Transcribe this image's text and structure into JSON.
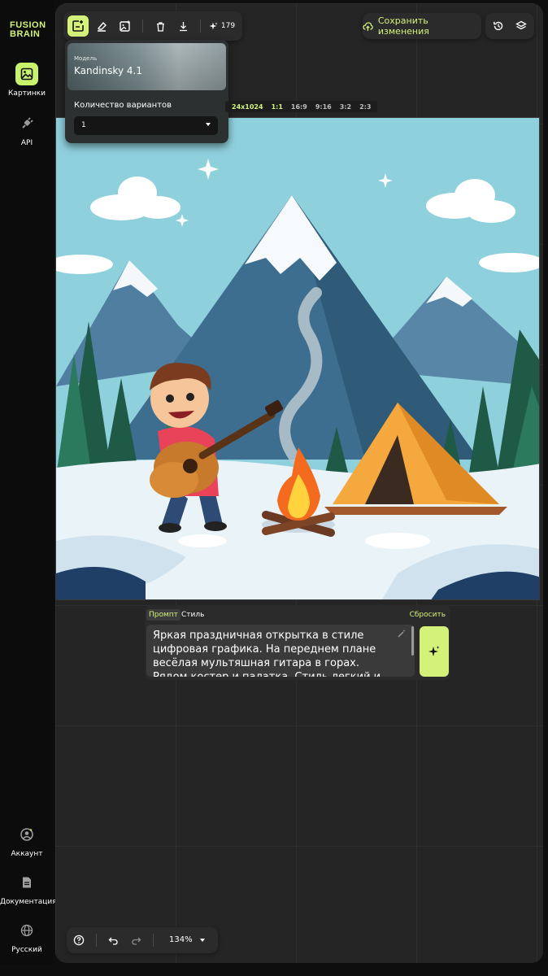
{
  "brand": {
    "line1": "FUSION",
    "line2": "BRAIN"
  },
  "sidebar": {
    "top": [
      {
        "label": "Картинки",
        "icon": "image-icon",
        "active": true
      },
      {
        "label": "API",
        "icon": "plug-icon",
        "active": false
      }
    ],
    "bottom": [
      {
        "label": "Аккаунт",
        "icon": "user-icon"
      },
      {
        "label": "Документация",
        "icon": "document-icon"
      },
      {
        "label": "Русский",
        "icon": "globe-icon"
      }
    ]
  },
  "toolbar": {
    "credits": "179",
    "save_label": "Сохранить изменения"
  },
  "model_panel": {
    "caption": "Модель",
    "model_name": "Kandinsky 4.1",
    "count_label": "Количество вариантов",
    "count_value": "1"
  },
  "aspect": {
    "size": "24x1024",
    "ratios": [
      "1:1",
      "16:9",
      "9:16",
      "3:2",
      "2:3"
    ],
    "selected": "1:1"
  },
  "prompt": {
    "tab_prompt": "Промпт",
    "tab_style": "Стиль",
    "reset": "Сбросить",
    "text": "Яркая праздничная открытка в стиле цифровая графика. На переднем плане весёлая мультяшная гитара в горах. Рядом костер и палатка. Стиль легкий и"
  },
  "bottom_bar": {
    "zoom": "134%"
  },
  "colors": {
    "accent": "#d4f27a",
    "workspace": "#252525",
    "sidebar": "#0c0c0c"
  }
}
